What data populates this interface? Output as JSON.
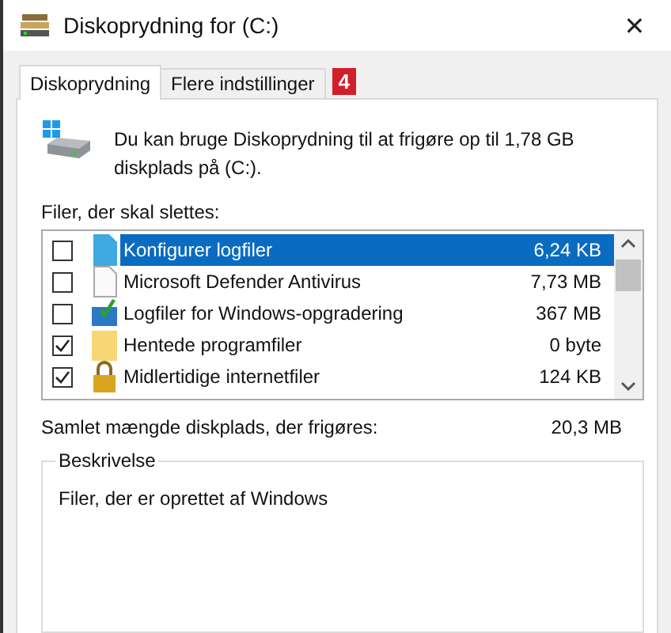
{
  "window": {
    "title": "Diskoprydning for  (C:)",
    "close": "✕"
  },
  "tabs": [
    {
      "label": "Diskoprydning",
      "selected": true
    },
    {
      "label": "Flere indstillinger",
      "selected": false
    }
  ],
  "badge": "4",
  "intro": "Du kan bruge Diskoprydning til at frigøre op til 1,78 GB diskplads på  (C:).",
  "files_label": "Filer, der skal slettes:",
  "files": [
    {
      "name": "Konfigurer logfiler",
      "size": "6,24 KB",
      "checked": false,
      "selected": true
    },
    {
      "name": "Microsoft Defender Antivirus",
      "size": "7,73 MB",
      "checked": false,
      "selected": false
    },
    {
      "name": "Logfiler for Windows-opgradering",
      "size": "367 MB",
      "checked": false,
      "selected": false
    },
    {
      "name": "Hentede programfiler",
      "size": "0 byte",
      "checked": true,
      "selected": false
    },
    {
      "name": "Midlertidige internetfiler",
      "size": "124 KB",
      "checked": true,
      "selected": false
    }
  ],
  "total": {
    "label": "Samlet mængde diskplads, der frigøres:",
    "value": "20,3 MB"
  },
  "description": {
    "title": "Beskrivelse",
    "text": "Filer, der er oprettet af Windows"
  }
}
